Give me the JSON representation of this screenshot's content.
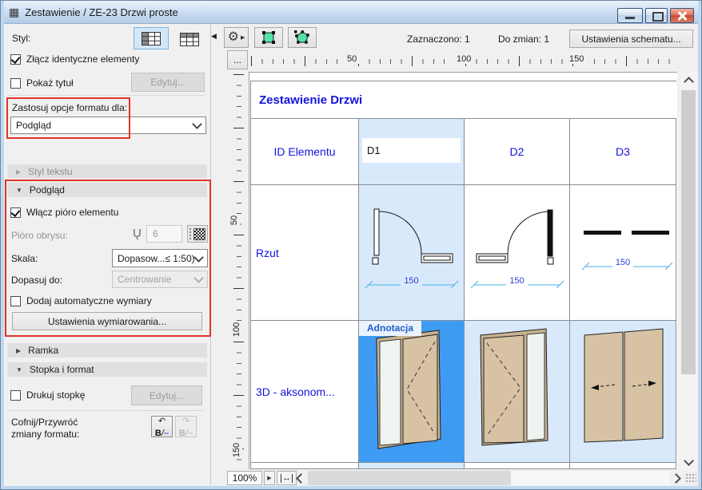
{
  "window": {
    "title": "Zestawienie / ZE-23 Drzwi proste"
  },
  "panel": {
    "style_label": "Styl:",
    "merge_checkbox": "Złącz identyczne elementy",
    "show_title_checkbox": "Pokaż tytuł",
    "edit_button": "Edytuj...",
    "apply_format_label": "Zastosuj opcje formatu dla:",
    "apply_format_value": "Podgląd",
    "section_text_style": "Styl tekstu",
    "section_preview": "Podgląd",
    "section_frame": "Ramka",
    "section_footer": "Stopka i format",
    "pen_checkbox": "Włącz pióro elementu",
    "pen_outline_label": "Pióro obrysu:",
    "pen_value": "6",
    "scale_label": "Skala:",
    "scale_value": "Dopasow...≤ 1:50)",
    "fit_label": "Dopasuj do:",
    "fit_value": "Centrowanie",
    "auto_dim_checkbox": "Dodaj automatyczne wymiary",
    "dim_settings_button": "Ustawienia wymiarowania...",
    "print_footer_checkbox": "Drukuj stopkę",
    "footer_edit_button": "Edytuj...",
    "undo_label_line1": "Cofnij/Przywróć",
    "undo_label_line2": "zmiany formatu:"
  },
  "toolbar": {
    "selected_count": "Zaznaczono: 1",
    "to_change_count": "Do zmian: 1",
    "scheme_settings_button": "Ustawienia schematu..."
  },
  "ruler": {
    "corner": "...",
    "h": [
      "50",
      "100",
      "150"
    ],
    "v": [
      "50",
      "100",
      "150"
    ]
  },
  "preview": {
    "table_title": "Zestawienie Drzwi",
    "row_id_label": "ID Elementu",
    "id_values": [
      "D1",
      "D2",
      "D3"
    ],
    "row_plan_label": "Rzut",
    "row_3d_label": "3D - aksonom...",
    "annotation_tag": "Adnotacja",
    "dim_value": "150"
  },
  "statusbar": {
    "zoom_level": "100%"
  },
  "icons": {
    "window": "▦",
    "gear": "⚙",
    "flyout": "▶",
    "collapse": "◀",
    "pen": "Ų",
    "fit_width": "↔",
    "undo_arrow": "↶",
    "redo_arrow": "↷",
    "format_b": "B",
    "format_slash": "/",
    "format_dash": "–",
    "section_open": "▼",
    "section_closed": "▶"
  },
  "colors": {
    "selection_blue": "#3E9BF4",
    "column_highlight": "#D9E9FC",
    "highlight_border": "#E0342B",
    "table_text_blue": "#1414DF",
    "dimension_cyan": "#45B2E4",
    "door_tan": "#D8C2A4"
  }
}
